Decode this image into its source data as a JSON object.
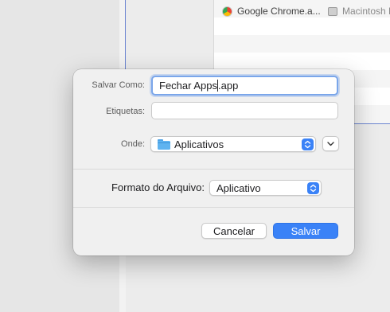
{
  "background": {
    "items": [
      {
        "label": "Google Chrome.a...",
        "icon": "chrome-icon"
      },
      {
        "label": "Macintosh H",
        "icon": "disk-icon"
      }
    ]
  },
  "dialog": {
    "save_as_label": "Salvar Como:",
    "filename_before_cursor": "Fechar Apps",
    "filename_after_cursor": ".app",
    "tags_label": "Etiquetas:",
    "tags_value": "",
    "where_label": "Onde:",
    "where_value": "Aplicativos",
    "where_icon": "folder-icon",
    "format_label": "Formato do Arquivo:",
    "format_value": "Aplicativo",
    "cancel_label": "Cancelar",
    "save_label": "Salvar"
  },
  "colors": {
    "accent": "#3a82f7",
    "focus_ring": "#7aa6ea"
  }
}
